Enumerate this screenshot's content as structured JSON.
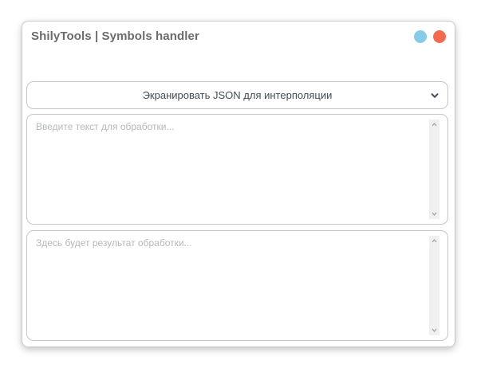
{
  "window": {
    "title": "ShilyTools | Symbols handler",
    "minimize_color": "#86cbe8",
    "close_color": "#f26a4f"
  },
  "mode_select": {
    "selected": "Экранировать JSON для интерполяции",
    "icon": "chevron-down-icon"
  },
  "input_area": {
    "value": "",
    "placeholder": "Введите текст для обработки..."
  },
  "output_area": {
    "value": "",
    "placeholder": "Здесь будет результат обработки..."
  },
  "scrollbar": {
    "up_icon": "arrow-up-icon",
    "down_icon": "arrow-down-icon"
  }
}
